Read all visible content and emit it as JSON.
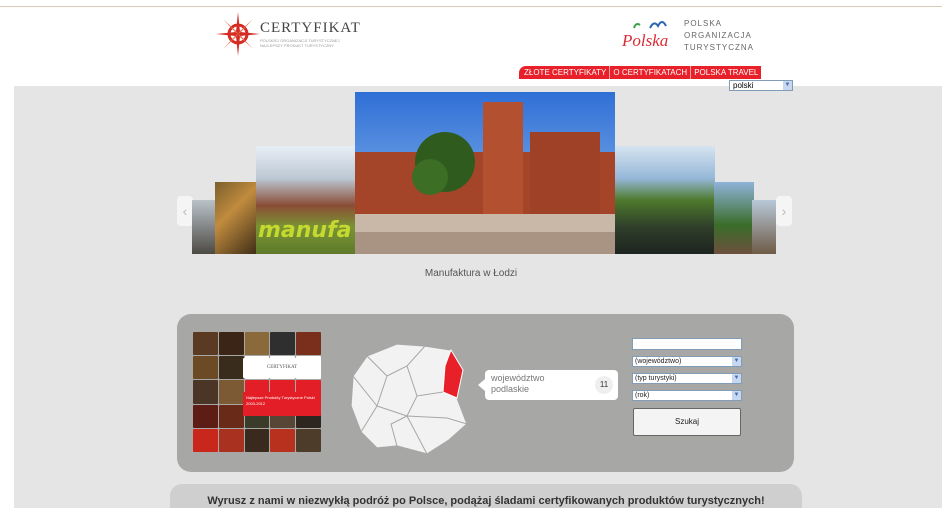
{
  "header": {
    "logo_title": "CERTYFIKAT",
    "logo_sub": [
      "POLSKIEJ ORGANIZACJI TURYSTYCZNEJ",
      "NAJLEPSZY PRODUKT TURYSTYCZNY"
    ],
    "polska_logo_text": "Polska",
    "pot_lines": [
      "POLSKA",
      "ORGANIZACJA",
      "TURYSTYCZNA"
    ]
  },
  "nav": {
    "items": [
      "ZŁOTE CERTYFIKATY",
      "O CERTYFIKATACH",
      "POLSKA TRAVEL"
    ],
    "language": "polski"
  },
  "carousel": {
    "caption": "Manufaktura w Łodzi",
    "prev_label": "‹",
    "next_label": "›",
    "manufa_text": "manufa"
  },
  "search": {
    "thumb_card_title": "CERTYFIKAT",
    "thumb_card_text": "Najlepsze Produkty Turystyczne Polski 2003-2012",
    "region_line1": "województwo",
    "region_line2": "podlaskie",
    "region_count": "11",
    "text_input_value": "",
    "select_region": "(województwo)",
    "select_type": "(typ turystyki)",
    "select_year": "(rok)",
    "submit_label": "Szukaj"
  },
  "tagline": "Wyrusz z nami w niezwykłą podróż po Polsce, podążaj śladami certyfikowanych produktów turystycznych!",
  "colors": {
    "accent": "#e8202a",
    "band": "#e6e5e5",
    "panel": "#a7a7a6"
  }
}
